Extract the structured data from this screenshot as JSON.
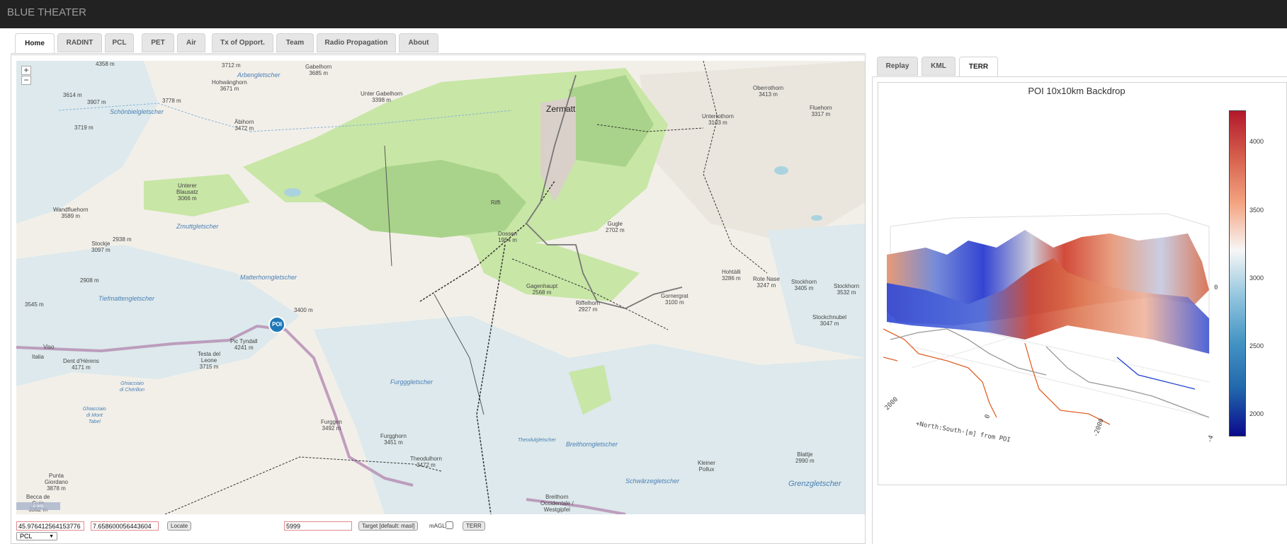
{
  "app": {
    "title": "BLUE THEATER"
  },
  "main_tabs": [
    {
      "label": "Home",
      "active": true
    },
    {
      "label": "RADINT",
      "active": false
    },
    {
      "label": "PCL",
      "active": false
    },
    {
      "label": "PET",
      "active": false
    },
    {
      "label": "Air",
      "active": false
    },
    {
      "label": "Tx of Opport.",
      "active": false
    },
    {
      "label": "Team",
      "active": false
    },
    {
      "label": "Radio Propagation",
      "active": false
    },
    {
      "label": "About",
      "active": false
    }
  ],
  "map": {
    "zoom_in": "+",
    "zoom_out": "−",
    "poi_marker": "POI",
    "scale_label": "2 km",
    "labels": {
      "zermatt": "Zermatt",
      "unter_gabelhorn": "Unter Gabelhorn\n3398 m",
      "gabelhorn": "Gabelhorn\n3685 m",
      "hohwanghorn": "Hohwänghorn\n3671 m",
      "arbengletscher": "Arbengletscher",
      "ablhorn": "Äbihorn\n3472 m",
      "schonbielgletscher": "Schönbielgletscher",
      "unterrothorn": "Unterrothorn\n3103 m",
      "oberrothorn": "Oberrothorn\n3413 m",
      "fluehorn": "Fluehorn\n3317 m",
      "unterer_biausatz": "Unterer\nBlausatz\n3066 m",
      "wandfluehorn": "Wandfluehorn\n3589 m",
      "zmuttgletscher": "Zmuttgletscher",
      "stockje": "Stockje\n3097 m",
      "v2938": "2938 m",
      "v2908": "2908 m",
      "matterhorngletscher": "Matterhorngletscher",
      "tiefmattengletscher": "Tiefmattengletscher",
      "pic_tyndall": "Pic Tyndall\n4241 m",
      "dent_herens": "Dent d'Hérens\n4171 m",
      "testa_leone": "Testa del\nLeone\n3715 m",
      "v3400": "3400 m",
      "riffelhorn": "Riffelhorn\n2927 m",
      "gagenhaupt": "Gagenhaupt\n2568 m",
      "dossen": "Dossen\n1954 m",
      "gugle": "Gugle\n2702 m",
      "gornergrat": "Gornergrat\n3100 m",
      "hohtalli": "Hohtälli\n3286 m",
      "rote_nase": "Rote Nase\n3247 m",
      "stockhorn": "Stockhorn\n3405 m",
      "stockhorn2": "Stockhorn\n3532 m",
      "stockhubel": "Stockchnubel\n3047 m",
      "furgggletscher": "Furgggletscher",
      "furggen": "Furggen\n3492 m",
      "furgghorn": "Furgghorn\n3451 m",
      "theodulhorn": "Theodulhorn\n3472 m",
      "theodulgletscher": "Theodulgletscher",
      "breithorngletscher": "Breithorngletscher",
      "kleiner_pollux": "Kleiner\nPollux",
      "blattje": "Blattje\n2990 m",
      "schwarzegletscher": "Schwärzegletscher",
      "grenzgletscher": "Grenzgletscher",
      "breithorn_occ": "Breithorn\nOccidentale /\nWestgipfel",
      "punta_giordano": "Punta\nGiordano\n3878 m",
      "becca": "Becca de\nGuin\n3362 m",
      "ghiacciaio_cherillon": "Ghiacciaio\ndi Chérillon",
      "ghiacciaio_mont_tabel": "Ghiacciaio\ndi Mont\nTabel",
      "riffi": "Riffi",
      "v4358": "4358 m",
      "v3712": "3712 m",
      "v3614": "3614 m",
      "v3907": "3907 m",
      "v3778": "3778 m",
      "v3719": "3719 m",
      "v3545": "3545 m",
      "italia": "Italia",
      "viso": "Viso"
    }
  },
  "controls": {
    "lat_value": "45.976412564153776",
    "lon_value": "7.658600056443604",
    "locate_label": "Locate",
    "alt_value": "5999",
    "target_label": "Target [default: masl]",
    "magl_label": "mAGL",
    "terr_label": "TERR",
    "select_value": "PCL"
  },
  "right_tabs": [
    {
      "label": "Replay",
      "active": false
    },
    {
      "label": "KML",
      "active": false
    },
    {
      "label": "TERR",
      "active": true
    }
  ],
  "plot": {
    "title": "POI 10x10km Backdrop",
    "colorbar_ticks": [
      "4000",
      "3500",
      "3000",
      "2500",
      "2000"
    ],
    "axis_label_north": "+North:South-[m] from POI",
    "tick_2000": "2000",
    "tick_0": "0",
    "tick_neg2000": "-2000",
    "tick_neg4": "-4",
    "tick_side": "0"
  },
  "colors": {
    "topbar": "#222222",
    "colorbar_high": "#b2182b",
    "colorbar_low": "#0a0a8c"
  }
}
